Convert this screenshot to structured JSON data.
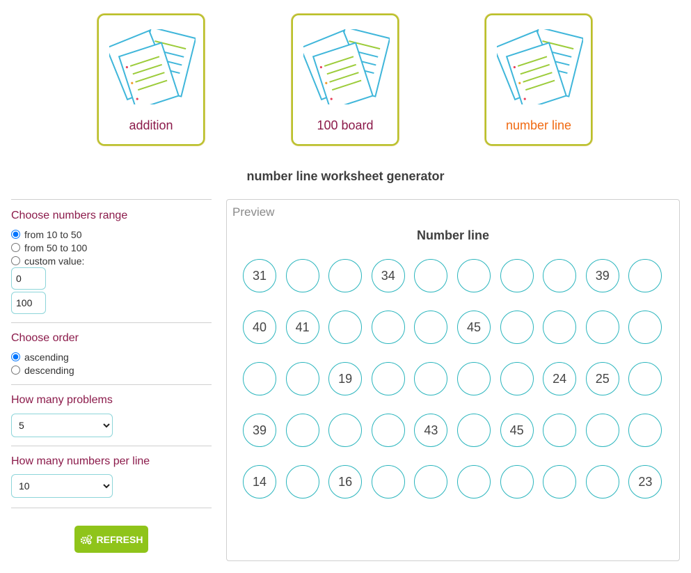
{
  "worksheet_types": [
    {
      "label": "addition"
    },
    {
      "label": "100 board"
    },
    {
      "label": "number line"
    }
  ],
  "page_title": "number line worksheet generator",
  "range": {
    "title": "Choose numbers range",
    "options": [
      "from 10 to 50",
      "from 50 to 100",
      "custom value:"
    ],
    "custom_min": "0",
    "custom_max": "100"
  },
  "order": {
    "title": "Choose order",
    "options": [
      "ascending",
      "descending"
    ]
  },
  "problems": {
    "title": "How many problems",
    "selected": "5"
  },
  "per_line": {
    "title": "How many numbers per line",
    "selected": "10"
  },
  "refresh_label": "REFRESH",
  "preview": {
    "label": "Preview",
    "title": "Number line",
    "rows": [
      [
        "31",
        "",
        "",
        "34",
        "",
        "",
        "",
        "",
        "39",
        ""
      ],
      [
        "40",
        "41",
        "",
        "",
        "",
        "45",
        "",
        "",
        "",
        ""
      ],
      [
        "",
        "",
        "19",
        "",
        "",
        "",
        "",
        "24",
        "25",
        ""
      ],
      [
        "39",
        "",
        "",
        "",
        "43",
        "",
        "45",
        "",
        "",
        ""
      ],
      [
        "14",
        "",
        "16",
        "",
        "",
        "",
        "",
        "",
        "",
        "23"
      ]
    ]
  },
  "colors": {
    "accent": "#8b1a4a",
    "active": "#f06a12",
    "circle": "#2ab5bd",
    "button": "#8fc41a"
  }
}
